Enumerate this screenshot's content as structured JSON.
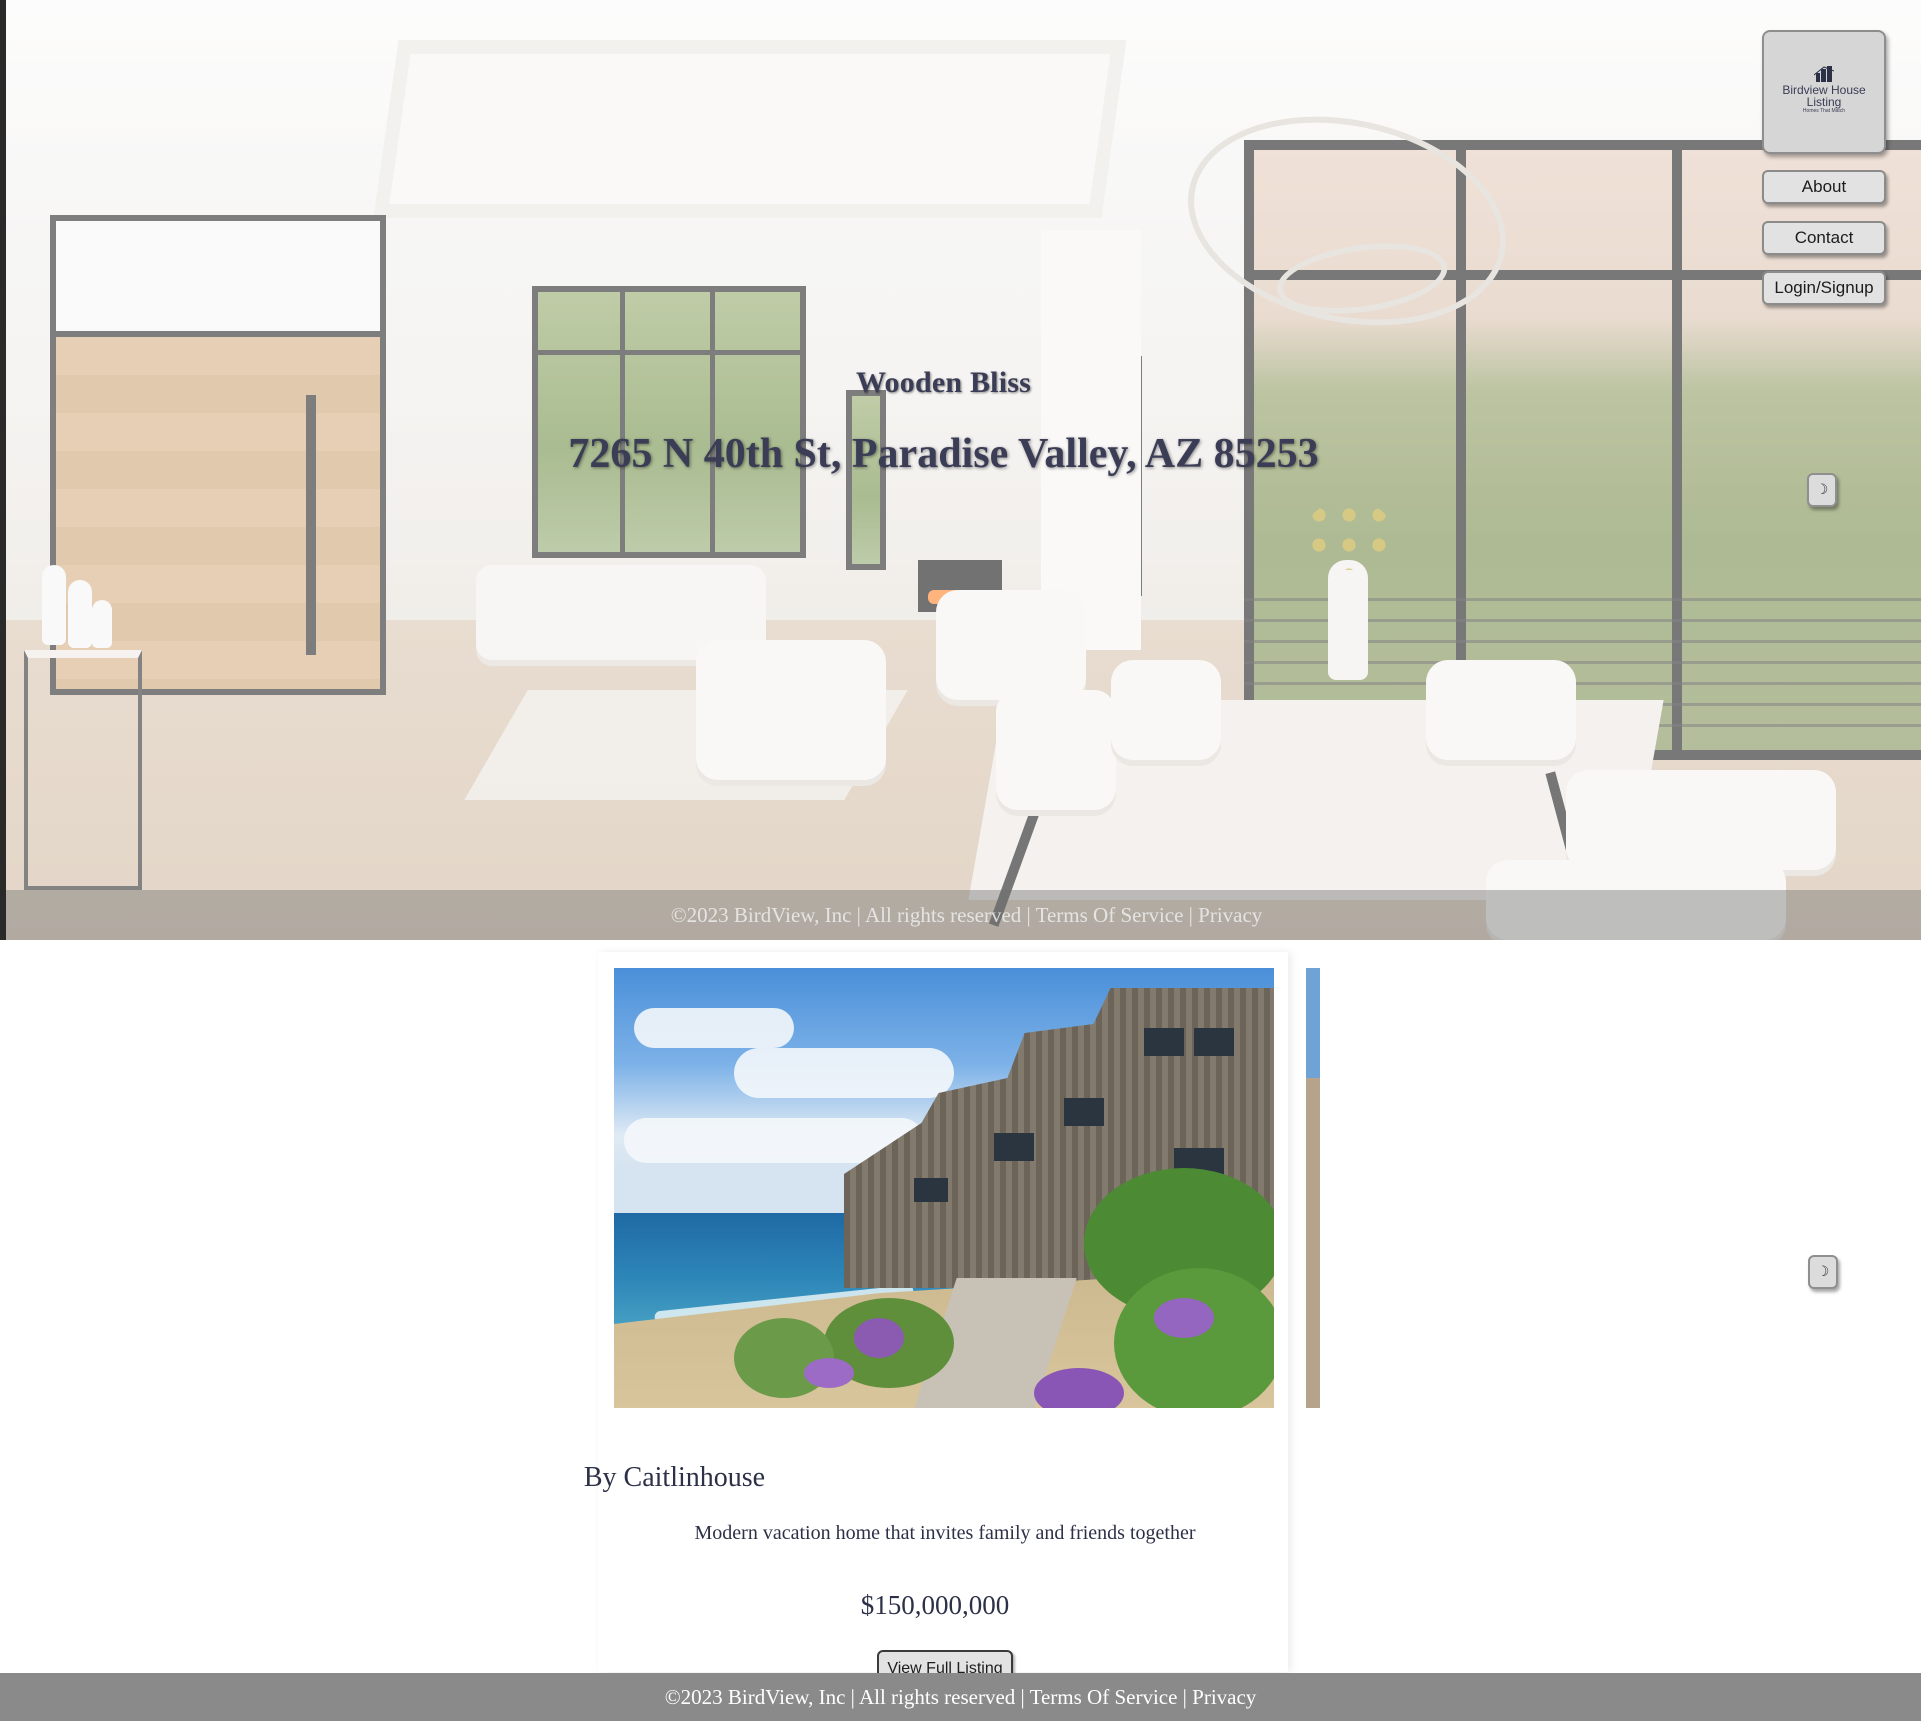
{
  "brand": {
    "logo_line1": "Birdview House Listing",
    "logo_line2": "Homes That Match"
  },
  "nav": {
    "items": [
      {
        "label": "About"
      },
      {
        "label": "Contact"
      },
      {
        "label": "Login/Signup"
      }
    ]
  },
  "theme_toggle": {
    "icon": "moon-icon",
    "glyph": "☽"
  },
  "hero": {
    "title": "Wooden Bliss",
    "address": "7265 N 40th St, Paradise Valley, AZ 85253"
  },
  "listing_card": {
    "author": "By Caitlinhouse",
    "description": "Modern vacation home that invites family and friends together",
    "price": "$150,000,000",
    "button_label": "View Full Listing"
  },
  "footer": {
    "copyright": "©2023 BirdView, Inc",
    "rights": "All rights reserved",
    "separator": "|",
    "terms": "Terms Of Service",
    "privacy": "Privacy"
  },
  "colors": {
    "text_primary": "#2c3147",
    "footer_bg": "#8a8a8a",
    "button_bg": "#e2e2e2"
  }
}
